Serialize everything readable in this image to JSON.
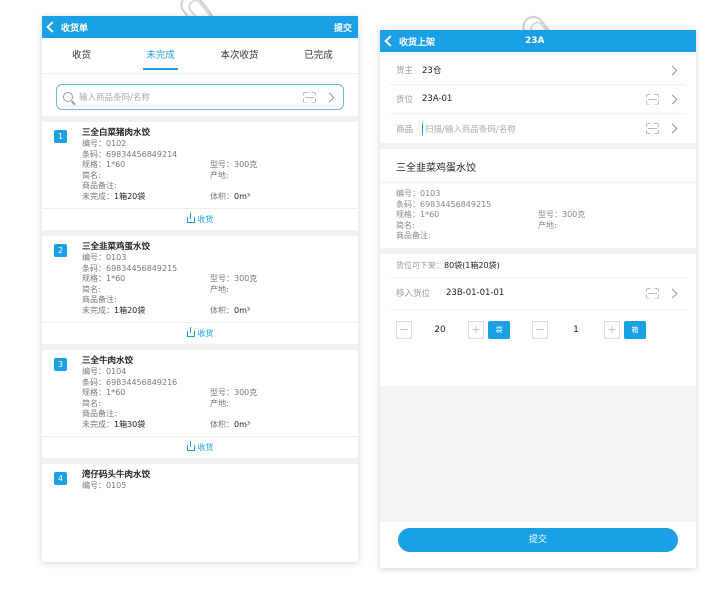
{
  "left": {
    "header": {
      "back_label": "收货单",
      "action_label": "提交"
    },
    "tabs": [
      {
        "label": "收货",
        "active": false
      },
      {
        "label": "未完成",
        "active": true
      },
      {
        "label": "本次收货",
        "active": false
      },
      {
        "label": "已完成",
        "active": false
      }
    ],
    "search": {
      "placeholder": "输入商品条码/名称"
    },
    "receive_label": "收货",
    "items": [
      {
        "num": "1",
        "name": "三全白菜猪肉水饺",
        "code": "编号：0102",
        "barcode": "条码：69834456849214",
        "spec": "规格：1*60",
        "model": "型号：300克",
        "short": "简名:",
        "origin": "产地:",
        "note": "商品备注:",
        "pending_label": "未完成：",
        "pending_value": "1箱20袋",
        "volume_label": "体积：",
        "volume_value": "0m³"
      },
      {
        "num": "2",
        "name": "三全韭菜鸡蛋水饺",
        "code": "编号：0103",
        "barcode": "条码：69834456849215",
        "spec": "规格：1*60",
        "model": "型号：300克",
        "short": "简名:",
        "origin": "产地:",
        "note": "商品备注:",
        "pending_label": "未完成：",
        "pending_value": "1箱20袋",
        "volume_label": "体积：",
        "volume_value": "0m³"
      },
      {
        "num": "3",
        "name": "三全牛肉水饺",
        "code": "编号：0104",
        "barcode": "条码：69834456849216",
        "spec": "规格：1*60",
        "model": "型号：300克",
        "short": "简名:",
        "origin": "产地:",
        "note": "商品备注:",
        "pending_label": "未完成：",
        "pending_value": "1箱30袋",
        "volume_label": "体积：",
        "volume_value": "0m³"
      },
      {
        "num": "4",
        "name": "湾仔码头牛肉水饺",
        "code": "编号：0105"
      }
    ]
  },
  "right": {
    "header": {
      "back_label": "收货上架",
      "center_label": "23A"
    },
    "rows": {
      "owner_label": "货主",
      "owner_value": "23仓",
      "location_label": "货位",
      "location_value": "23A-01",
      "product_label": "商品",
      "product_placeholder": "扫描/输入商品条码/名称"
    },
    "product": {
      "title": "三全韭菜鸡蛋水饺",
      "code": "编号：0103",
      "barcode": "条码：69834456849215",
      "spec": "规格：1*60",
      "model": "型号：300克",
      "short": "简名:",
      "origin": "产地:",
      "note": "商品备注:"
    },
    "available_label": "货位可下架：",
    "available_value": "80袋(1箱20袋)",
    "move_label": "移入货位",
    "move_value": "23B-01-01-01",
    "qty1": {
      "value": "20",
      "unit": "袋"
    },
    "qty2": {
      "value": "1",
      "unit": "箱"
    },
    "minus": "−",
    "plus": "+",
    "submit_label": "提交"
  },
  "colors": {
    "accent": "#1aa0e6"
  }
}
